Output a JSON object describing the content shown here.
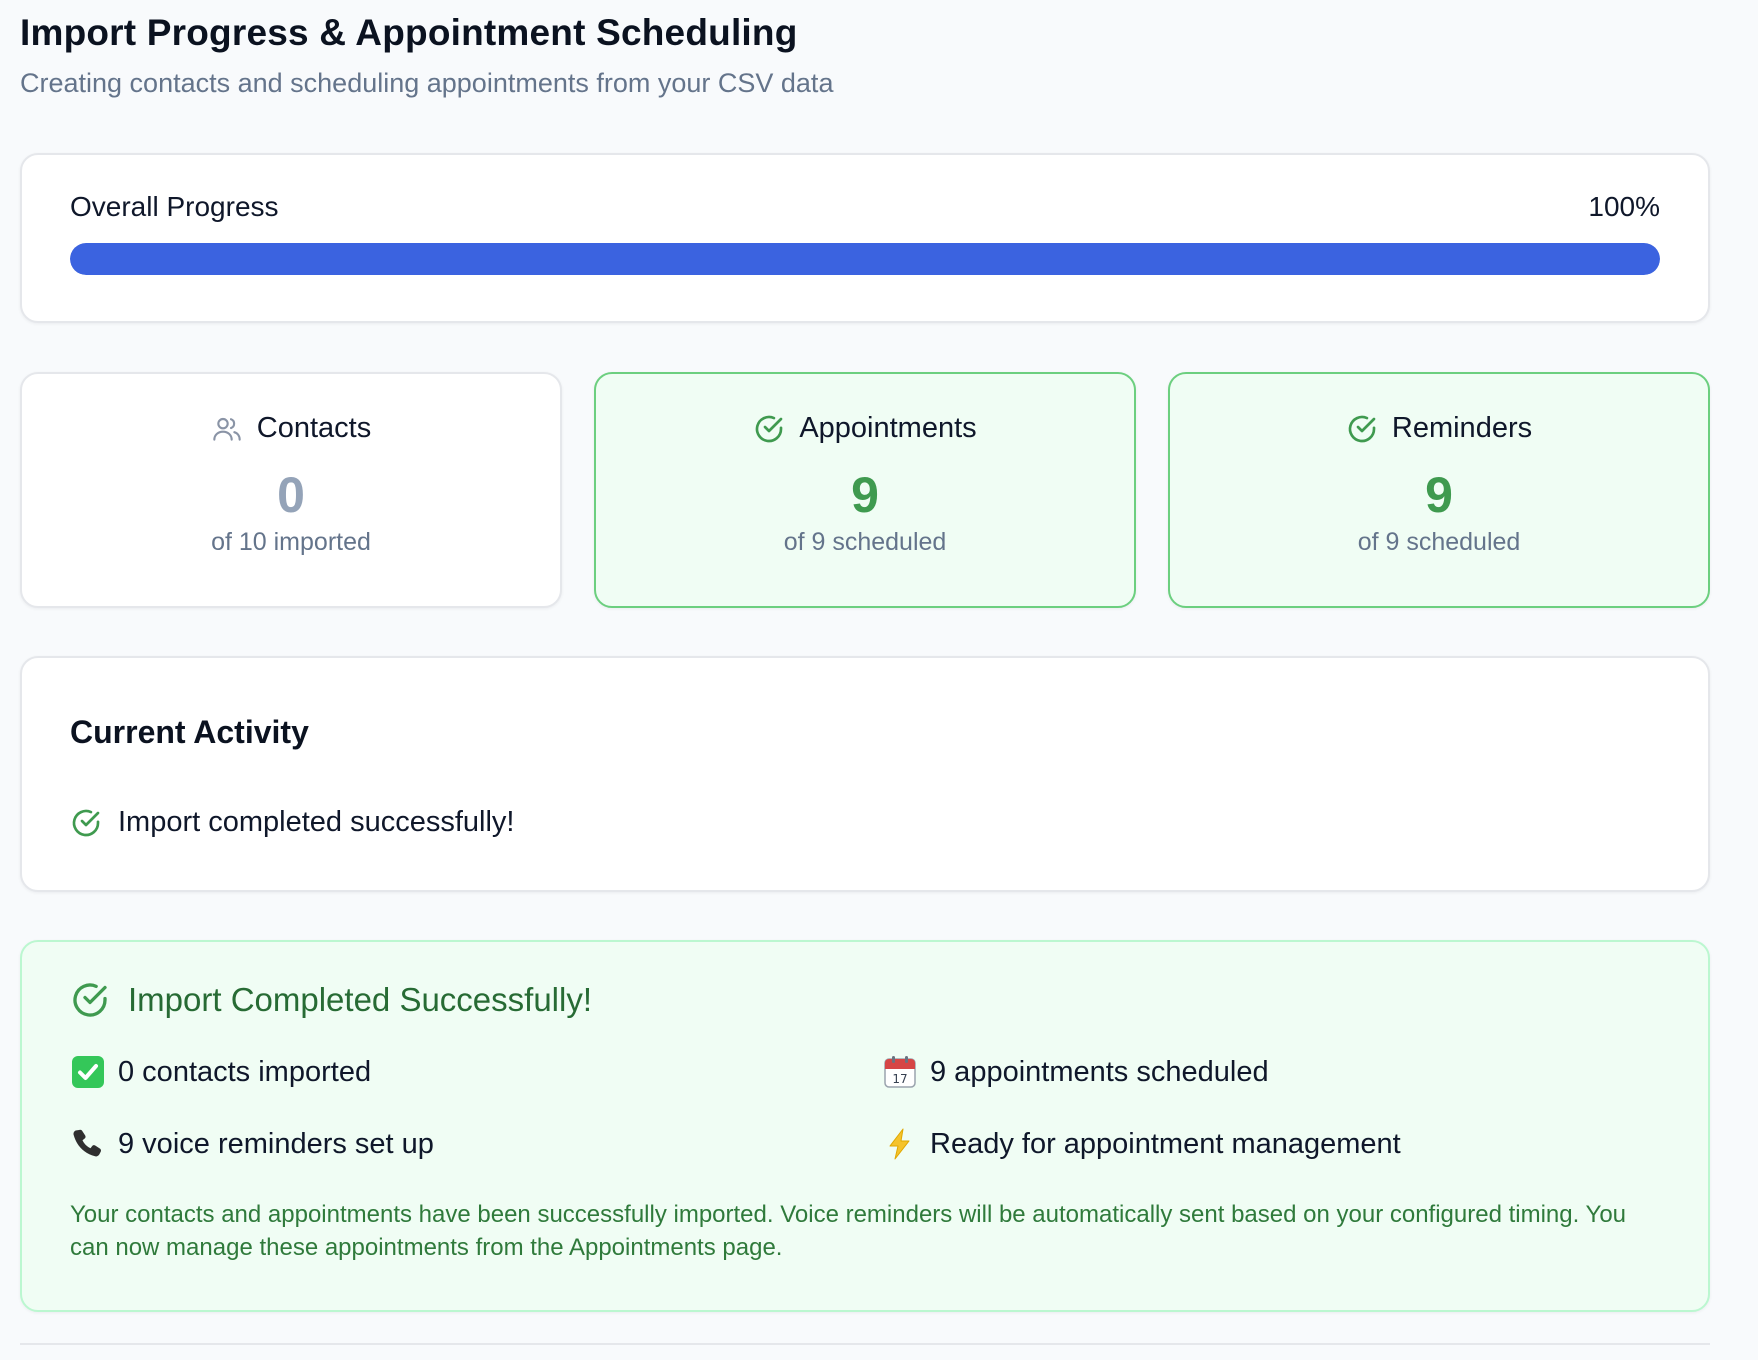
{
  "header": {
    "title": "Import Progress & Appointment Scheduling",
    "subtitle": "Creating contacts and scheduling appointments from your CSV data"
  },
  "progress": {
    "label": "Overall Progress",
    "value_text": "100%",
    "fraction": 1.0,
    "bar_color": "#3b63e0"
  },
  "stats": [
    {
      "label": "Contacts",
      "value": "0",
      "sub": "of 10 imported",
      "icon": "users-icon",
      "state": "pending"
    },
    {
      "label": "Appointments",
      "value": "9",
      "sub": "of 9 scheduled",
      "icon": "check-circle-icon",
      "state": "success"
    },
    {
      "label": "Reminders",
      "value": "9",
      "sub": "of 9 scheduled",
      "icon": "check-circle-icon",
      "state": "success"
    }
  ],
  "activity": {
    "title": "Current Activity",
    "message": "Import completed successfully!",
    "icon": "check-circle-icon"
  },
  "summary": {
    "title": "Import Completed Successfully!",
    "items": [
      {
        "icon": "check-mark-emoji",
        "text": "0 contacts imported"
      },
      {
        "icon": "calendar-emoji",
        "text": "9 appointments scheduled"
      },
      {
        "icon": "telephone-emoji",
        "text": "9 voice reminders set up"
      },
      {
        "icon": "lightning-emoji",
        "text": "Ready for appointment management"
      }
    ],
    "note": "Your contacts and appointments have been successfully imported. Voice reminders will be automatically sent based on your configured timing. You can now manage these appointments from the Appointments page."
  },
  "colors": {
    "accent_blue": "#3b63e0",
    "success_green": "#3f9a4f",
    "success_bg": "#f0fdf4",
    "muted_text": "#64748b"
  }
}
